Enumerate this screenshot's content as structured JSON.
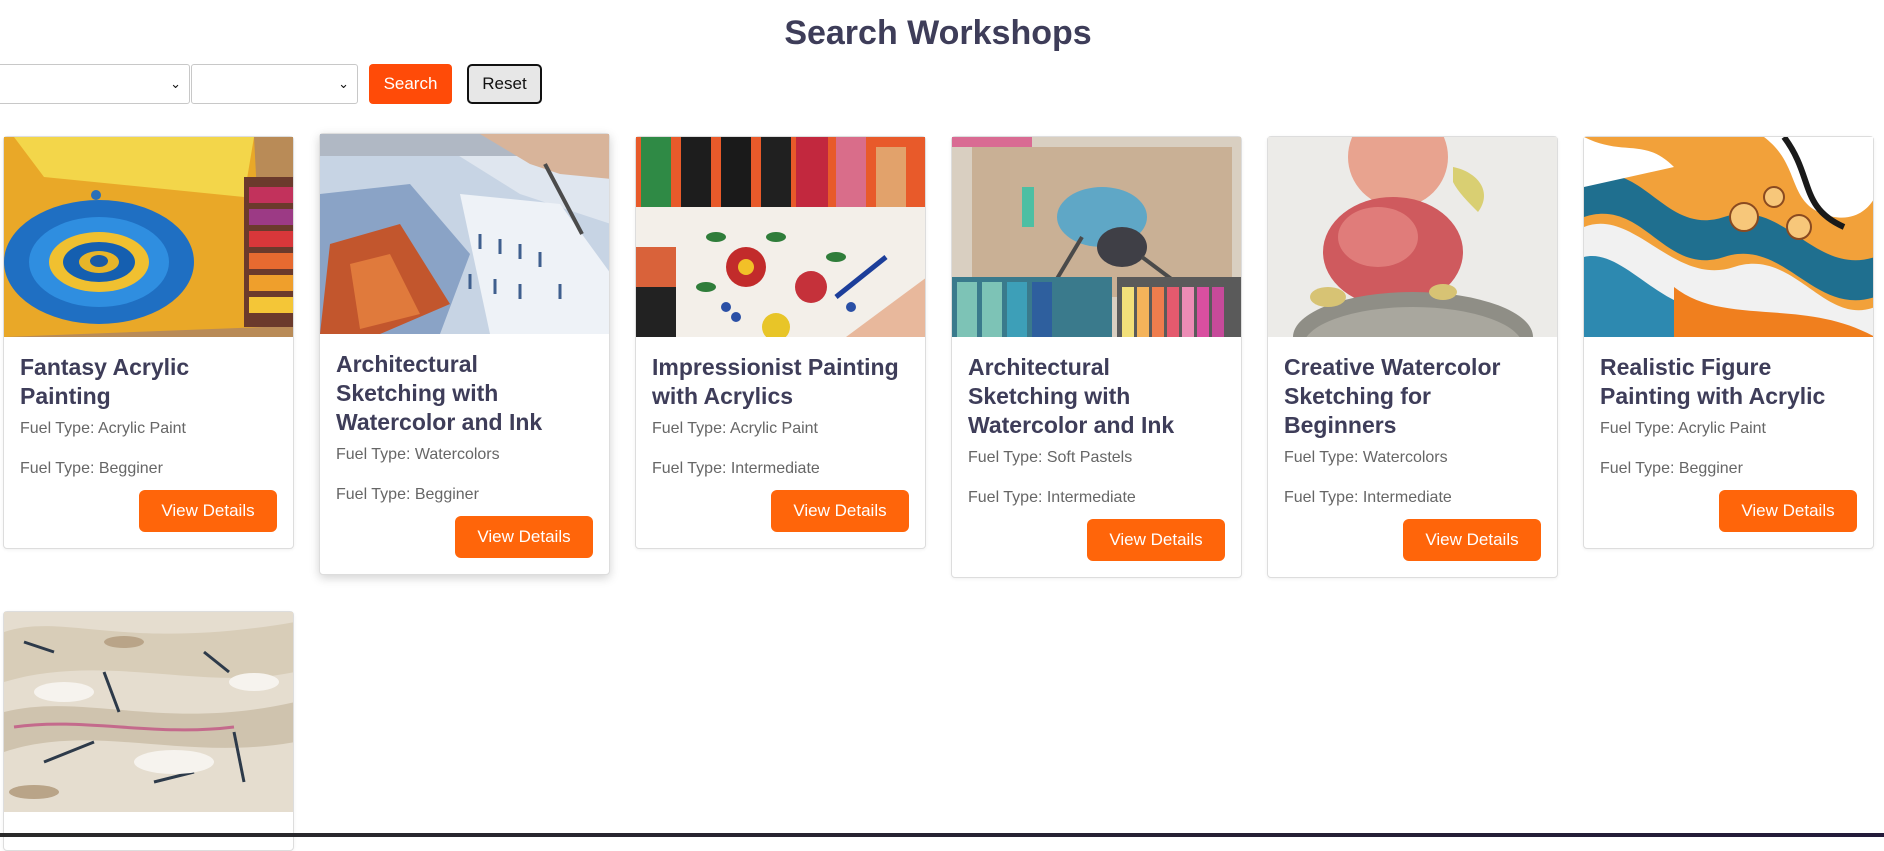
{
  "header": {
    "title": "Search Workshops"
  },
  "filters": {
    "search_label": "Search",
    "reset_label": "Reset",
    "select1_value": "",
    "select2_value": ""
  },
  "colors": {
    "accent": "#ff650a",
    "search": "#ff4b08",
    "title": "#3e3d59"
  },
  "workshops": [
    {
      "title": "Fantasy Acrylic Painting",
      "meta1": "Fuel Type: Acrylic Paint",
      "meta2": "Fuel Type: Begginer",
      "button": "View Details",
      "image": "water-drop-ripple-painting"
    },
    {
      "title": "Architectural Sketching with Watercolor and Ink",
      "meta1": "Fuel Type: Watercolors",
      "meta2": "Fuel Type: Begginer",
      "button": "View Details",
      "image": "hand-drawing-building"
    },
    {
      "title": "Impressionist Painting with Acrylics",
      "meta1": "Fuel Type: Acrylic Paint",
      "meta2": "Fuel Type: Intermediate",
      "button": "View Details",
      "image": "paint-bottles-flowers"
    },
    {
      "title": "Architectural Sketching with Watercolor and Ink",
      "meta1": "Fuel Type: Soft Pastels",
      "meta2": "Fuel Type: Intermediate",
      "button": "View Details",
      "image": "pastel-dancer-drawing"
    },
    {
      "title": "Creative Watercolor Sketching for Beginners",
      "meta1": "Fuel Type: Watercolors",
      "meta2": "Fuel Type: Intermediate",
      "button": "View Details",
      "image": "watercolor-mushroom"
    },
    {
      "title": "Realistic Figure Painting with Acrylic",
      "meta1": "Fuel Type: Acrylic Paint",
      "meta2": "Fuel Type: Begginer",
      "button": "View Details",
      "image": "acrylic-pour-marble"
    },
    {
      "title": "",
      "meta1": "",
      "meta2": "",
      "button": "",
      "image": "impasto-texture"
    }
  ]
}
